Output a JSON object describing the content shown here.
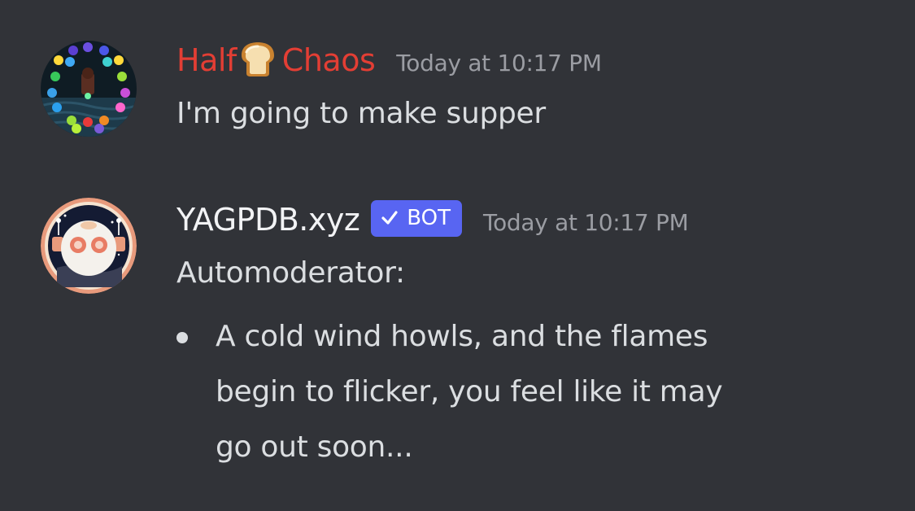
{
  "messages": [
    {
      "author": {
        "name_part1": "Half",
        "name_emoji": "bread-emoji",
        "name_part2": "Chaos",
        "color": "#e33e34"
      },
      "timestamp": "Today at 10:17 PM",
      "text": "I'm going to make supper"
    },
    {
      "author": {
        "name": "YAGPDB.xyz",
        "color": "#f2f3f5"
      },
      "badge": {
        "label": "BOT",
        "icon": "checkmark-icon",
        "color": "#5865f2"
      },
      "timestamp": "Today at 10:17 PM",
      "text": "Automoderator:",
      "bullets": [
        {
          "line1": "A cold wind howls, and the flames",
          "line2": "begin to flicker, you feel like it may",
          "line3": "go out soon..."
        }
      ]
    }
  ]
}
